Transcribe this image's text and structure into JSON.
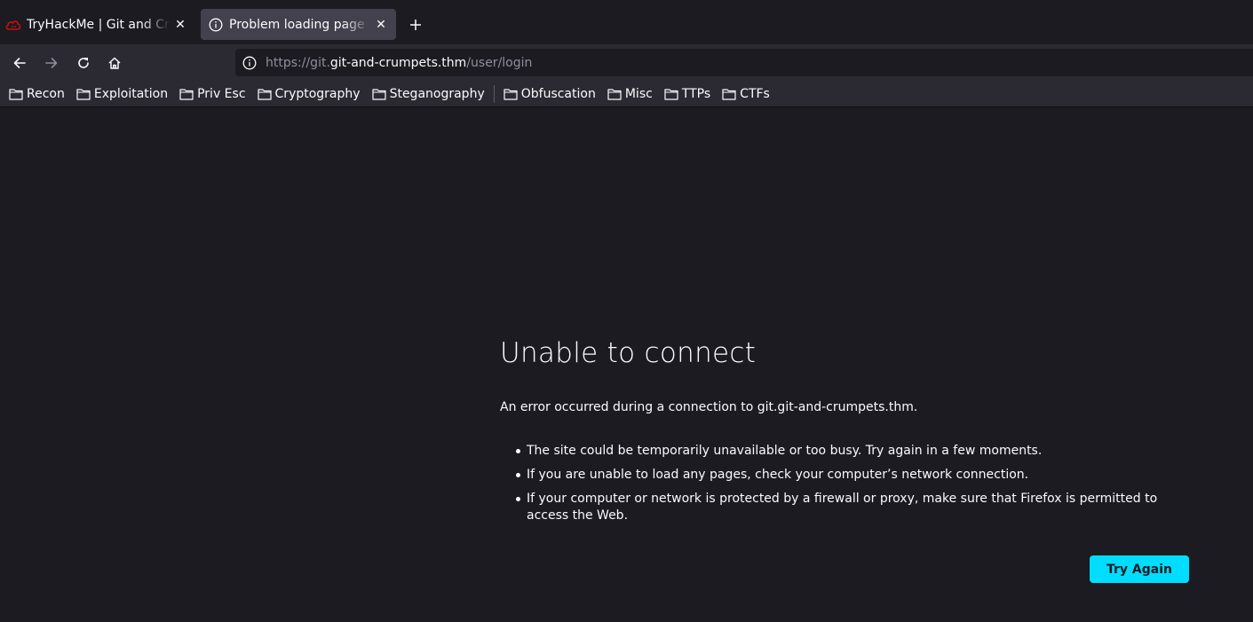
{
  "tabs": [
    {
      "title": "TryHackMe | Git and Crumpets",
      "icon": "tryhackme-cloud-icon",
      "active": false
    },
    {
      "title": "Problem loading page",
      "icon": "info-icon",
      "active": true
    }
  ],
  "navbar": {
    "url_prefix": "https://git.",
    "url_domain": "git-and-crumpets.thm",
    "url_path": "/user/login"
  },
  "bookmarks": [
    {
      "label": "Recon"
    },
    {
      "label": "Exploitation"
    },
    {
      "label": "Priv Esc"
    },
    {
      "label": "Cryptography"
    },
    {
      "label": "Steganography"
    },
    {
      "label": "Obfuscation"
    },
    {
      "label": "Misc"
    },
    {
      "label": "TTPs"
    },
    {
      "label": "CTFs"
    }
  ],
  "error": {
    "title": "Unable to connect",
    "description": "An error occurred during a connection to git.git-and-crumpets.thm.",
    "bullets": [
      "The site could be temporarily unavailable or too busy. Try again in a few moments.",
      "If you are unable to load any pages, check your computer’s network connection.",
      "If your computer or network is protected by a firewall or proxy, make sure that Firefox is permitted to access the Web."
    ],
    "button_label": "Try Again"
  },
  "colors": {
    "accent": "#00ddff",
    "background": "#1c1b22",
    "toolbar": "#2b2a33",
    "active_tab": "#42414d"
  }
}
